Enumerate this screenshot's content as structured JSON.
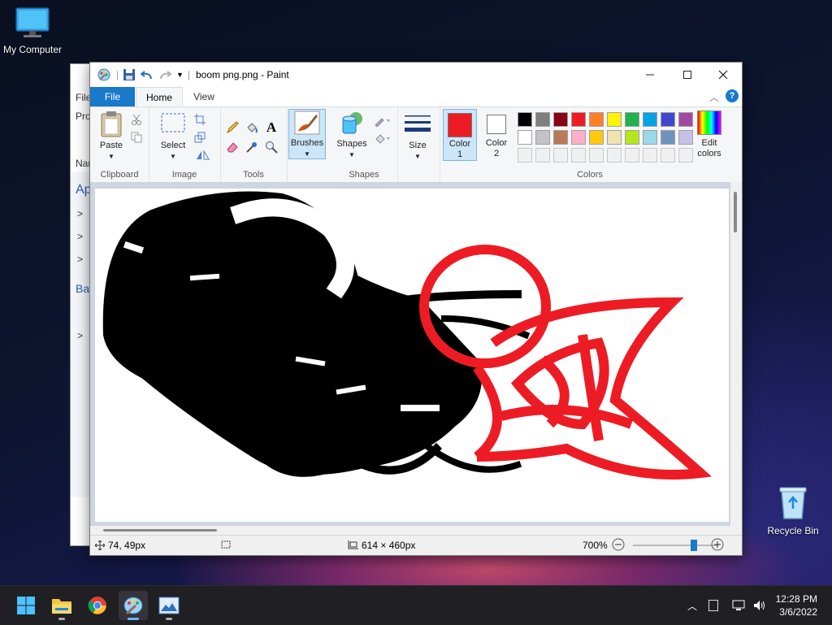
{
  "desktop": {
    "computer_label": "My Computer",
    "recycle_label": "Recycle Bin"
  },
  "bg_window": {
    "lines": [
      "File",
      "Pro",
      "Nan",
      "Ap",
      ">",
      ">",
      ">",
      "Ba",
      ">"
    ]
  },
  "paint": {
    "title": "boom png.png - Paint",
    "tabs": {
      "file": "File",
      "home": "Home",
      "view": "View"
    },
    "groups": {
      "clipboard": "Clipboard",
      "image": "Image",
      "tools": "Tools",
      "shapes": "Shapes",
      "colors": "Colors"
    },
    "buttons": {
      "paste": "Paste",
      "select": "Select",
      "brushes": "Brushes",
      "shapes": "Shapes",
      "size": "Size",
      "color1": "Color",
      "color1_num": "1",
      "color2": "Color",
      "color2_num": "2",
      "edit_colors_1": "Edit",
      "edit_colors_2": "colors"
    },
    "colors": {
      "color1": "#ed1c24",
      "color2": "#ffffff",
      "row1": [
        "#000000",
        "#7f7f7f",
        "#880015",
        "#ed1c24",
        "#ff7f27",
        "#fff200",
        "#22b14c",
        "#00a2e8",
        "#3f48cc",
        "#a349a4"
      ],
      "row2": [
        "#ffffff",
        "#c3c3c3",
        "#b97a57",
        "#ffaec9",
        "#ffc90e",
        "#efe4b0",
        "#b5e61d",
        "#99d9ea",
        "#7092be",
        "#c8bfe7"
      ],
      "row3": [
        "#f0f0f0",
        "#f0f0f0",
        "#f0f0f0",
        "#f0f0f0",
        "#f0f0f0",
        "#f0f0f0",
        "#f0f0f0",
        "#f0f0f0",
        "#f0f0f0",
        "#f0f0f0"
      ]
    },
    "status": {
      "cursor_pos": "74, 49px",
      "image_size": "614 × 460px",
      "zoom": "700%",
      "zoom_level": 0.72
    }
  },
  "taskbar": {
    "time": "12:28 PM",
    "date": "3/6/2022"
  }
}
